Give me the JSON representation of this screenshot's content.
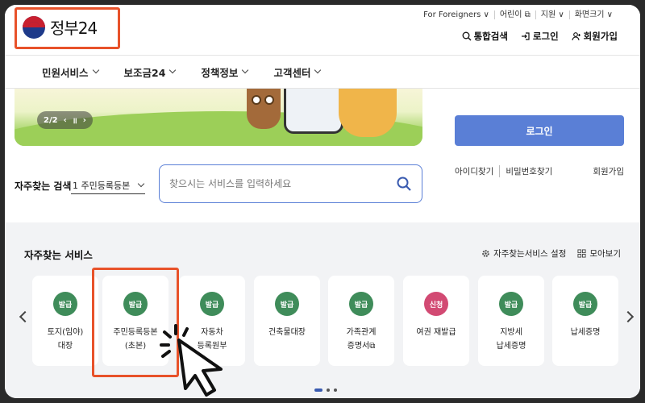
{
  "header": {
    "logo_text": "정부24",
    "util_links": [
      "For Foreigners ∨",
      "어린이 ⧉",
      "지원 ∨",
      "화면크기 ∨"
    ],
    "search_label": "통합검색",
    "login_label": "로그인",
    "signup_label": "회원가입"
  },
  "nav": {
    "items": [
      "민원서비스",
      "보조금24",
      "정책정보",
      "고객센터"
    ]
  },
  "hero": {
    "pager_text": "2/2",
    "prev": "‹",
    "pause": "॥",
    "next": "›"
  },
  "login_panel": {
    "login_button": "로그인",
    "find_id": "아이디찾기",
    "find_pw": "비밀번호찾기",
    "signup": "회원가입"
  },
  "faq_search": {
    "label": "자주찾는 검색",
    "selected": "1 주민등록등본",
    "placeholder": "찾으시는 서비스를 입력하세요"
  },
  "services": {
    "title": "자주찾는 서비스",
    "settings_label": "자주찾는서비스 설정",
    "viewall_label": "모아보기",
    "cards": [
      {
        "badge": "발급",
        "label": "토지(임야)\n대장",
        "badge_color": "#3f8c5a"
      },
      {
        "badge": "발급",
        "label": "주민등록등본\n(초본)",
        "badge_color": "#3f8c5a"
      },
      {
        "badge": "발급",
        "label": "자동차\n등록원부",
        "badge_color": "#3f8c5a"
      },
      {
        "badge": "발급",
        "label": "건축물대장",
        "badge_color": "#3f8c5a"
      },
      {
        "badge": "발급",
        "label": "가족관계\n증명서⧉",
        "badge_color": "#3f8c5a"
      },
      {
        "badge": "신청",
        "label": "여권 재발급",
        "badge_color": "#d24a73"
      },
      {
        "badge": "발급",
        "label": "지방세\n납세증명",
        "badge_color": "#3f8c5a"
      },
      {
        "badge": "발급",
        "label": "납세증명",
        "badge_color": "#3f8c5a"
      }
    ]
  },
  "colors": {
    "accent": "#5a7fd6",
    "highlight": "#e8522a",
    "badge_green": "#3f8c5a",
    "badge_pink": "#d24a73"
  }
}
